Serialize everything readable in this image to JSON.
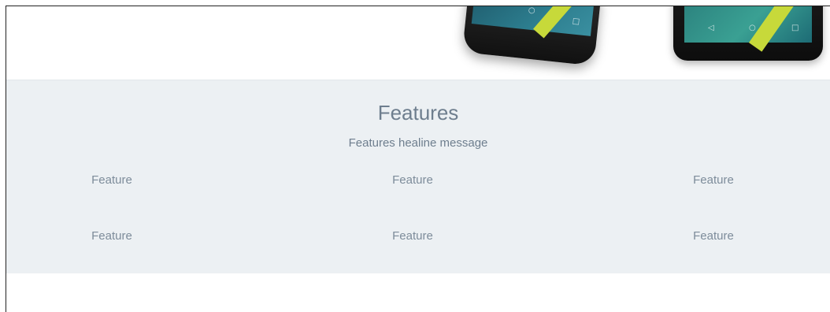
{
  "features": {
    "title": "Features",
    "subtitle": "Features healine message",
    "rows": [
      [
        "Feature",
        "Feature",
        "Feature"
      ],
      [
        "Feature",
        "Feature",
        "Feature"
      ]
    ]
  },
  "colors": {
    "section_background": "#ecf0f3",
    "heading_text": "#6e7e8e",
    "item_text": "#7d8c9a"
  }
}
